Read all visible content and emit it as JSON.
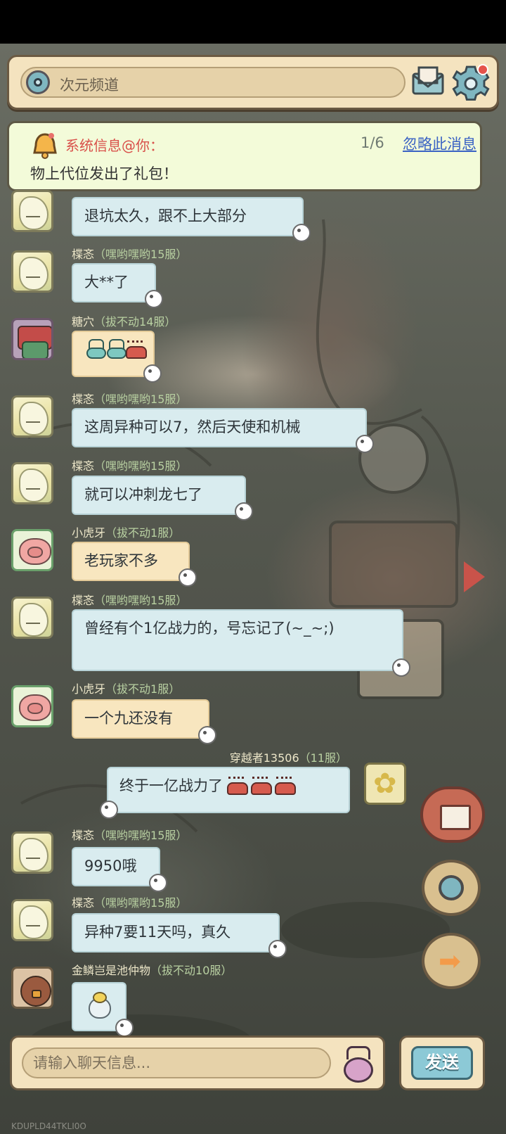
{
  "header": {
    "channel_name": "次元频道"
  },
  "notice": {
    "title": "系统信息@你：",
    "page": "1/6",
    "ignore_label": "忽略此消息",
    "body": "物上代位发出了礼包！"
  },
  "messages": [
    {
      "avatar": "blond",
      "side": "left",
      "name": "",
      "server": "",
      "text": "退坑太久，跟不上大部分",
      "style": "blue"
    },
    {
      "avatar": "blond",
      "side": "left",
      "name": "楪忞",
      "server": "（嘿哟嘿哟15服）",
      "text": "大**了",
      "style": "blue"
    },
    {
      "avatar": "monster",
      "side": "left",
      "name": "糖穴",
      "server": "（拔不动14服）",
      "text": "",
      "style": "cream",
      "emoji": "slug-crab"
    },
    {
      "avatar": "blond",
      "side": "left",
      "name": "楪忞",
      "server": "（嘿哟嘿哟15服）",
      "text": "这周异种可以7，然后天使和机械",
      "style": "blue"
    },
    {
      "avatar": "blond",
      "side": "left",
      "name": "楪忞",
      "server": "（嘿哟嘿哟15服）",
      "text": "就可以冲刺龙七了",
      "style": "blue"
    },
    {
      "avatar": "pig",
      "side": "left",
      "name": "小虎牙",
      "server": "（拔不动1服）",
      "text": "老玩家不多",
      "style": "cream"
    },
    {
      "avatar": "blond",
      "side": "left",
      "name": "楪忞",
      "server": "（嘿哟嘿哟15服）",
      "text": "曾经有个1亿战力的，号忘记了(~_~;)",
      "style": "blue"
    },
    {
      "avatar": "pig",
      "side": "left",
      "name": "小虎牙",
      "server": "（拔不动1服）",
      "text": "一个九还没有",
      "style": "cream"
    },
    {
      "avatar": "flower",
      "side": "right",
      "name": "穿越者13506",
      "server": "（11服）",
      "text": "终于一亿战力了",
      "style": "blue",
      "emoji": "crabs"
    },
    {
      "avatar": "blond",
      "side": "left",
      "name": "楪忞",
      "server": "（嘿哟嘿哟15服）",
      "text": "9950哦",
      "style": "blue"
    },
    {
      "avatar": "blond",
      "side": "left",
      "name": "楪忞",
      "server": "（嘿哟嘿哟15服）",
      "text": "异种7要11天吗，真久",
      "style": "blue"
    },
    {
      "avatar": "bird",
      "side": "left",
      "name": "金鳞岂是池仲物",
      "server": "（拔不动10服）",
      "text": "",
      "style": "blue",
      "emoji": "egg"
    }
  ],
  "input": {
    "placeholder": "请输入聊天信息...",
    "send_label": "发送"
  },
  "footer_id": "KDUPLD44TKLI0O",
  "icons": {
    "channel": "channel-ring-icon",
    "mail": "mail-icon",
    "settings": "gear-icon",
    "bell": "bell-icon",
    "emoji": "emoji-icon"
  },
  "colors": {
    "panel": "#f4e3bf",
    "border": "#6b5a43",
    "notice_title": "#d9504a",
    "link": "#3b63c4",
    "bubble_blue": "#d9ecef",
    "bubble_cream": "#f8e6bf"
  }
}
